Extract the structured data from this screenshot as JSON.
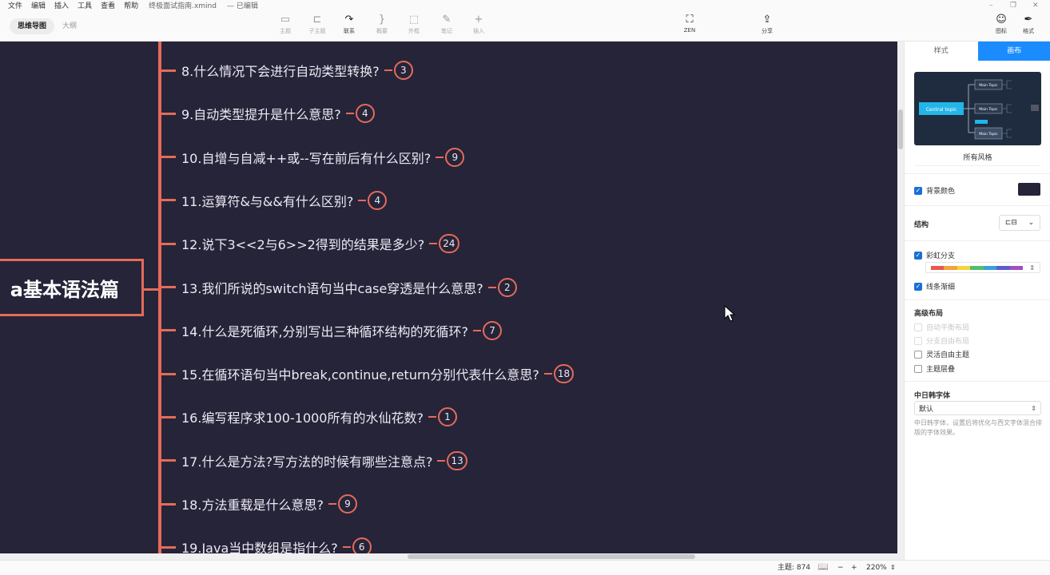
{
  "menu": [
    "文件",
    "编辑",
    "插入",
    "工具",
    "查看",
    "帮助"
  ],
  "document": {
    "filename": "终极面试指南.xmind",
    "status": "— 已编辑"
  },
  "view_tabs": [
    {
      "label": "思维导图",
      "active": true
    },
    {
      "label": "大纲",
      "active": false
    }
  ],
  "toolbar": [
    {
      "icon": "topic-icon",
      "glyph": "▭",
      "label": "主题"
    },
    {
      "icon": "subtopic-icon",
      "glyph": "⊏",
      "label": "子主题"
    },
    {
      "icon": "relationship-icon",
      "glyph": "↷",
      "label": "联系"
    },
    {
      "icon": "summary-icon",
      "glyph": "}",
      "label": "概要"
    },
    {
      "icon": "boundary-icon",
      "glyph": "⬚",
      "label": "外框"
    },
    {
      "icon": "note-icon",
      "glyph": "✎",
      "label": "笔记"
    },
    {
      "icon": "insert-icon",
      "glyph": "+",
      "label": "插入"
    }
  ],
  "zen": {
    "glyph": "⛶",
    "label": "ZEN"
  },
  "share": {
    "glyph": "⇪",
    "label": "分享"
  },
  "right_tools": [
    {
      "glyph": "☺",
      "label": "图标"
    },
    {
      "glyph": "✒",
      "label": "格式"
    }
  ],
  "central_topic": "a基本语法篇",
  "topics": [
    {
      "text": "8.什么情况下会进行自动类型转换?",
      "count": "3"
    },
    {
      "text": "9.自动类型提升是什么意思?",
      "count": "4"
    },
    {
      "text": "10.自增与自减++或--写在前后有什么区别?",
      "count": "9"
    },
    {
      "text": "11.运算符&与&&有什么区别?",
      "count": "4"
    },
    {
      "text": "12.说下3<<2与6>>2得到的结果是多少?",
      "count": "24"
    },
    {
      "text": "13.我们所说的switch语句当中case穿透是什么意思?",
      "count": "2"
    },
    {
      "text": "14.什么是死循环,分别写出三种循环结构的死循环?",
      "count": "7"
    },
    {
      "text": "15.在循环语句当中break,continue,return分别代表什么意思?",
      "count": "18"
    },
    {
      "text": "16.编写程序求100-1000所有的水仙花数?",
      "count": "1"
    },
    {
      "text": "17.什么是方法?写方法的时候有哪些注意点?",
      "count": "13"
    },
    {
      "text": "18.方法重载是什么意思?",
      "count": "9"
    },
    {
      "text": "19.Java当中数组是指什么?",
      "count": "6"
    }
  ],
  "panel": {
    "tabs": [
      {
        "label": "样式",
        "active": false
      },
      {
        "label": "画布",
        "active": true
      }
    ],
    "preview": {
      "central": "Central topic",
      "main": "Main Topic"
    },
    "preview_caption": "所有风格",
    "bg_color": {
      "label": "背景颜色",
      "checked": true,
      "value": "#262439"
    },
    "structure": {
      "label": "结构",
      "glyph": "⊏⊟"
    },
    "rainbow": {
      "label": "彩虹分支",
      "checked": true,
      "colors": [
        "#e8584f",
        "#f4a23b",
        "#f2d43b",
        "#4fbf6b",
        "#3aa0d8",
        "#5b5bd6",
        "#a04fc0"
      ]
    },
    "taper": {
      "label": "线条渐细",
      "checked": true
    },
    "advanced_layout": {
      "title": "高级布局",
      "options": [
        {
          "label": "自动平衡布局",
          "checked": false,
          "disabled": true
        },
        {
          "label": "分支自由布局",
          "checked": false,
          "disabled": true
        },
        {
          "label": "灵活自由主题",
          "checked": false,
          "disabled": false
        },
        {
          "label": "主题层叠",
          "checked": false,
          "disabled": false
        }
      ]
    },
    "cjk_font": {
      "title": "中日韩字体",
      "value": "默认",
      "note": "中日韩字体，设置后将优化与西文字体混合排版的字体效果。"
    }
  },
  "status": {
    "topics": "主题: 874",
    "zoom": "220%",
    "zoom_out": "−",
    "zoom_in": "+"
  }
}
